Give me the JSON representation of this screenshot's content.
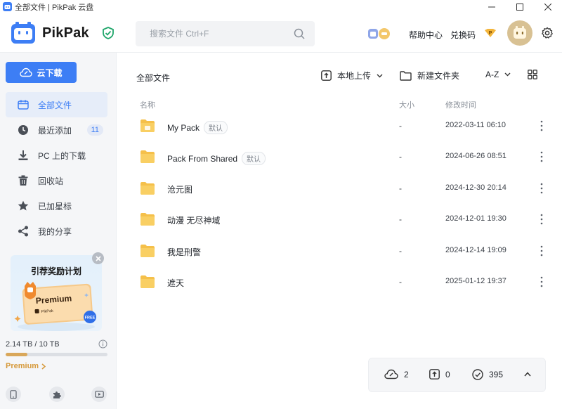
{
  "window": {
    "title": "全部文件 | PikPak 云盘"
  },
  "header": {
    "brand": "PikPak",
    "search_placeholder": "搜索文件 Ctrl+F",
    "help_label": "帮助中心",
    "redeem_label": "兑换码",
    "premium_badge_letter": "P"
  },
  "sidebar": {
    "cloud_download_label": "云下载",
    "items": [
      {
        "label": "全部文件",
        "icon": "folder-icon",
        "active": true
      },
      {
        "label": "最近添加",
        "icon": "clock-icon",
        "badge": "11"
      },
      {
        "label": "PC 上的下载",
        "icon": "download-icon"
      },
      {
        "label": "回收站",
        "icon": "trash-icon"
      },
      {
        "label": "已加星标",
        "icon": "star-icon"
      },
      {
        "label": "我的分享",
        "icon": "share-icon"
      }
    ],
    "promo": {
      "title": "引荐奖励计划",
      "card_label": "Premium",
      "card_brand": "PikPak",
      "free_badge": "FREE"
    },
    "storage": {
      "text": "2.14 TB / 10 TB",
      "used_fraction": 0.214
    },
    "premium_link": "Premium"
  },
  "main": {
    "breadcrumb": "全部文件",
    "toolbar": {
      "upload_label": "本地上传",
      "new_folder_label": "新建文件夹",
      "sort_label": "A-Z"
    },
    "columns": {
      "name": "名称",
      "size": "大小",
      "modified": "修改时间"
    },
    "files": [
      {
        "name": "My Pack",
        "tag": "默认",
        "size": "-",
        "modified": "2022-03-11 06:10"
      },
      {
        "name": "Pack From Shared",
        "tag": "默认",
        "size": "-",
        "modified": "2024-06-26 08:51"
      },
      {
        "name": "沧元图",
        "size": "-",
        "modified": "2024-12-30 20:14"
      },
      {
        "name": "动漫 无尽神域",
        "size": "-",
        "modified": "2024-12-01 19:30"
      },
      {
        "name": "我是刑警",
        "size": "-",
        "modified": "2024-12-14 19:09"
      },
      {
        "name": "遮天",
        "size": "-",
        "modified": "2025-01-12 19:37"
      }
    ]
  },
  "transfer_panel": {
    "cloud_count": "2",
    "upload_count": "0",
    "done_count": "395"
  },
  "colors": {
    "accent": "#3d7ef5",
    "folder": "#f5c04a",
    "premium": "#d69a3c"
  }
}
